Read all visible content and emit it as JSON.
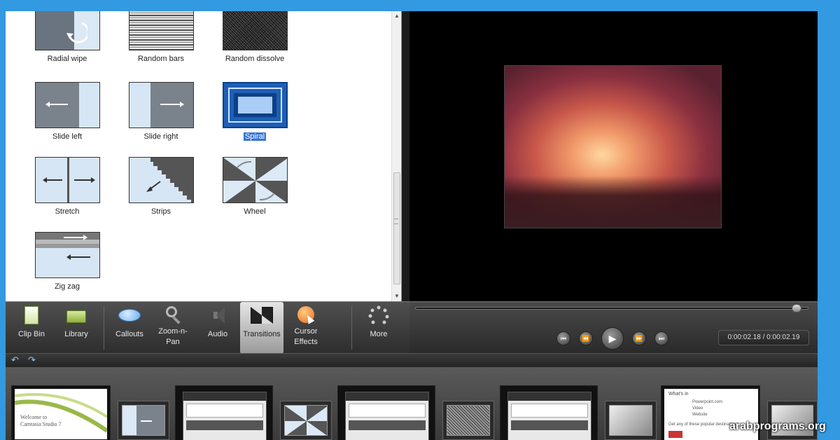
{
  "transitions": [
    {
      "label": "Radial wipe",
      "selected": false
    },
    {
      "label": "Random bars",
      "selected": false
    },
    {
      "label": "Random dissolve",
      "selected": false
    },
    {
      "label": "Slide left",
      "selected": false
    },
    {
      "label": "Slide right",
      "selected": false
    },
    {
      "label": "Spiral",
      "selected": true
    },
    {
      "label": "Stretch",
      "selected": false
    },
    {
      "label": "Strips",
      "selected": false
    },
    {
      "label": "Wheel",
      "selected": false
    },
    {
      "label": "Zig zag",
      "selected": false
    }
  ],
  "toolbar": {
    "clip_bin": "Clip Bin",
    "library": "Library",
    "callouts": "Callouts",
    "zoom_line1": "Zoom-n-",
    "zoom_line2": "Pan",
    "audio": "Audio",
    "transitions": "Transitions",
    "cursor_line1": "Cursor",
    "cursor_line2": "Effects",
    "more": "More",
    "active_tool": "transitions"
  },
  "playback": {
    "time": "0:00:02.18 / 0:00:02.19",
    "seek_progress": 0.97
  },
  "storyboard": {
    "clip1_line1": "Welcome to",
    "clip1_line2": "Camtasia Studio 7",
    "clip5_title": "What's in",
    "clip5_item1": "Powerpoint.com",
    "clip5_item2": "Video",
    "clip5_item3": "Website",
    "clip5_footer": "Get any of these popular destinations"
  },
  "watermark": "arabprograms.org",
  "colors": {
    "page_bg": "#3399e0",
    "selection": "#3875d7"
  }
}
